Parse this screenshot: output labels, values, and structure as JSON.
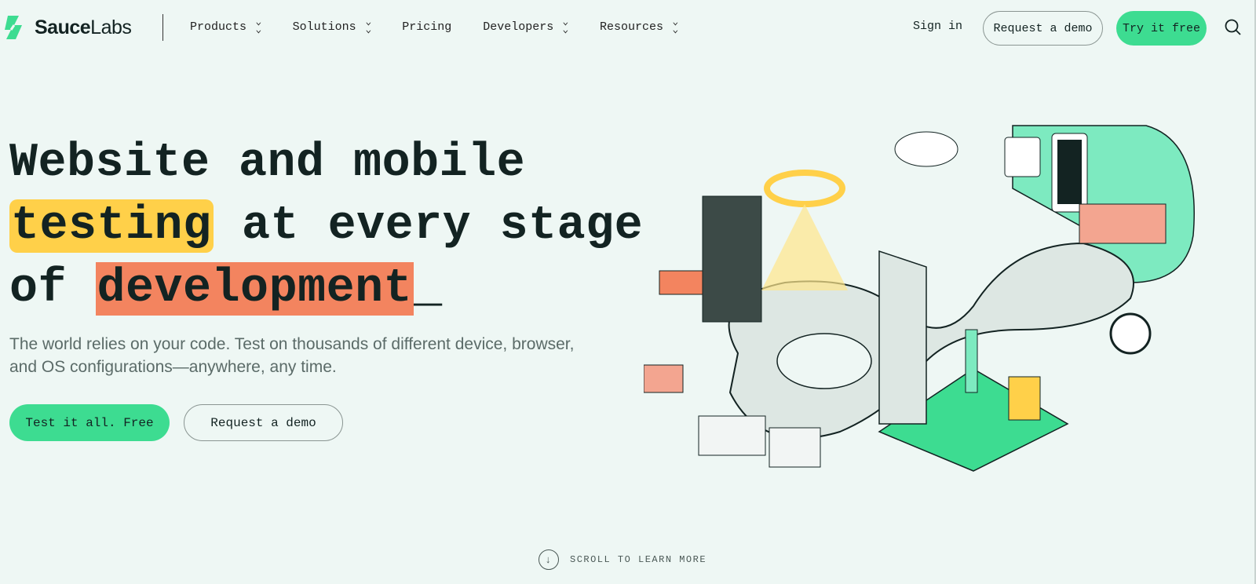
{
  "brand": {
    "name_bold": "Sauce",
    "name_light": "Labs",
    "accent": "#3ddc91"
  },
  "nav": {
    "items": [
      {
        "label": "Products",
        "has_dropdown": true
      },
      {
        "label": "Solutions",
        "has_dropdown": true
      },
      {
        "label": "Pricing",
        "has_dropdown": false
      },
      {
        "label": "Developers",
        "has_dropdown": true
      },
      {
        "label": "Resources",
        "has_dropdown": true
      }
    ],
    "sign_in": "Sign in",
    "request_demo": "Request a demo",
    "try_free": "Try it free",
    "search_icon": "search-icon"
  },
  "hero": {
    "line1": "Website and mobile",
    "highlight1": "testing",
    "line2_rest": " at every stage",
    "line3_prefix": "of ",
    "highlight2": "development",
    "cursor": "_",
    "subtitle": "The world relies on your code. Test on thousands of different device, browser, and OS configurations—anywhere, any time.",
    "cta_primary": "Test it all. Free",
    "cta_secondary": "Request a demo",
    "colors": {
      "highlight_yellow": "#ffd049",
      "highlight_orange": "#f3845f"
    }
  },
  "scroll": {
    "label": "SCROLL TO LEARN MORE",
    "icon": "arrow-down-circle-icon"
  }
}
